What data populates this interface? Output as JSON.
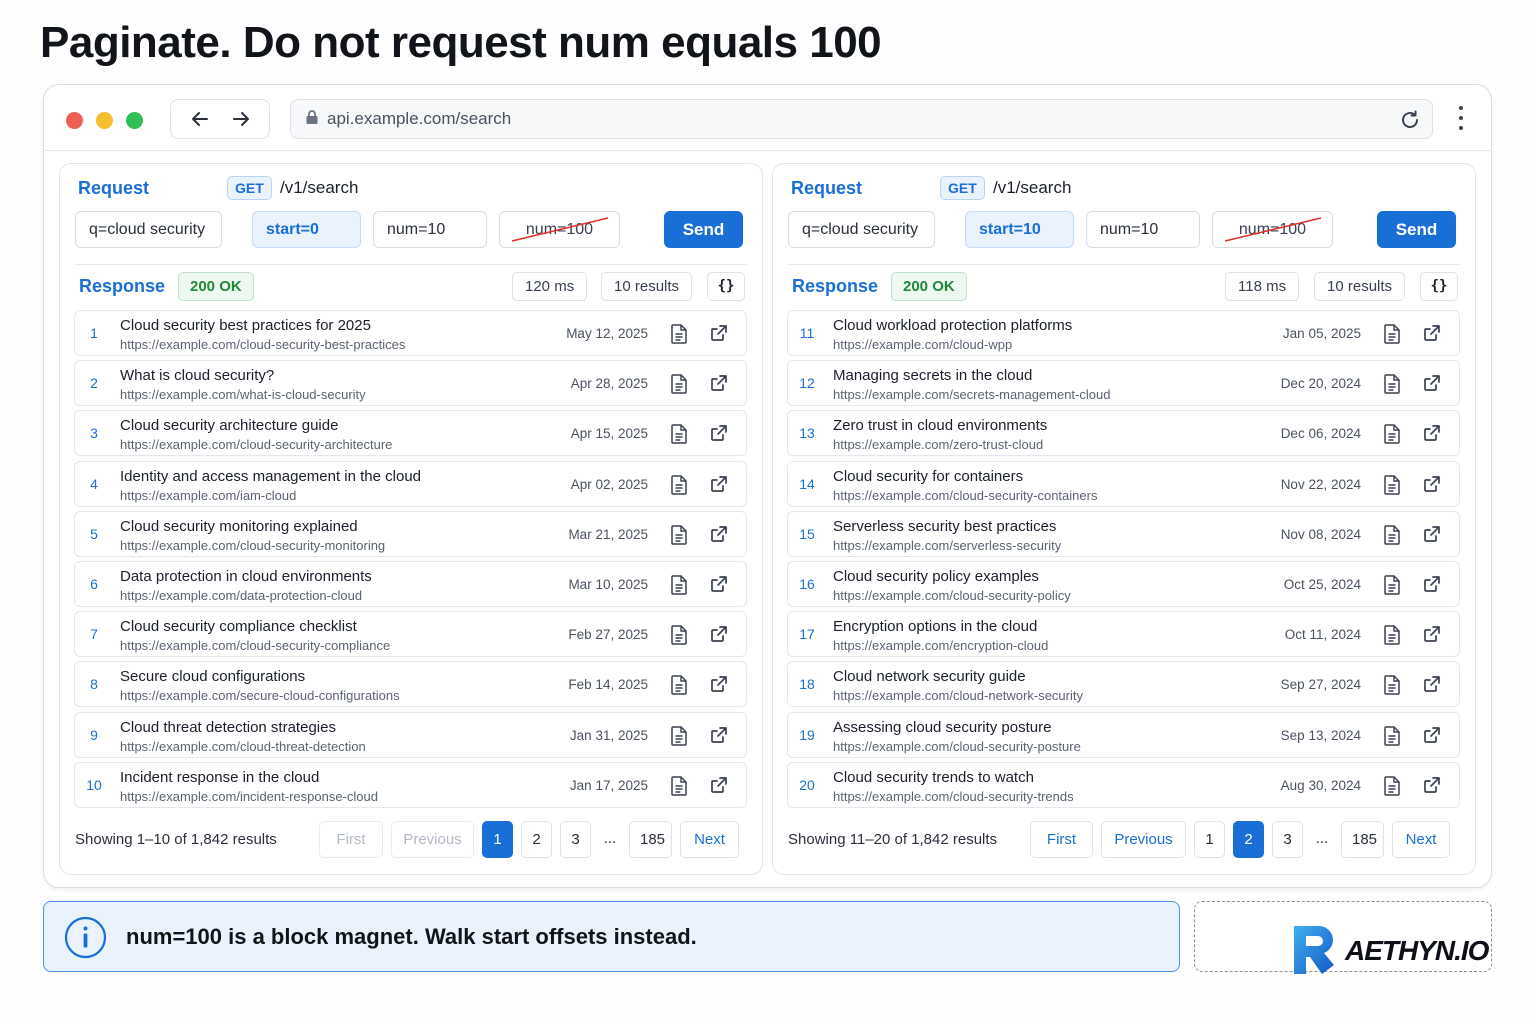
{
  "page_title": "Paginate. Do not request num equals 100",
  "browser": {
    "url": "api.example.com/search"
  },
  "panels": [
    {
      "request_label": "Request",
      "method": "GET",
      "path": "/v1/search",
      "params": {
        "q": "q=cloud security",
        "start": "start=0",
        "num": "num=10",
        "struck": "num=100"
      },
      "send_label": "Send",
      "response_label": "Response",
      "status": "200 OK",
      "time": "120 ms",
      "count": "10 results",
      "json_label": "{}",
      "results": [
        {
          "n": "1",
          "title": "Cloud security best practices for 2025",
          "url": "https://example.com/cloud-security-best-practices",
          "date": "May 12, 2025"
        },
        {
          "n": "2",
          "title": "What is cloud security?",
          "url": "https://example.com/what-is-cloud-security",
          "date": "Apr 28, 2025"
        },
        {
          "n": "3",
          "title": "Cloud security architecture guide",
          "url": "https://example.com/cloud-security-architecture",
          "date": "Apr 15, 2025"
        },
        {
          "n": "4",
          "title": "Identity and access management in the cloud",
          "url": "https://example.com/iam-cloud",
          "date": "Apr 02, 2025"
        },
        {
          "n": "5",
          "title": "Cloud security monitoring explained",
          "url": "https://example.com/cloud-security-monitoring",
          "date": "Mar 21, 2025"
        },
        {
          "n": "6",
          "title": "Data protection in cloud environments",
          "url": "https://example.com/data-protection-cloud",
          "date": "Mar 10, 2025"
        },
        {
          "n": "7",
          "title": "Cloud security compliance checklist",
          "url": "https://example.com/cloud-security-compliance",
          "date": "Feb 27, 2025"
        },
        {
          "n": "8",
          "title": "Secure cloud configurations",
          "url": "https://example.com/secure-cloud-configurations",
          "date": "Feb 14, 2025"
        },
        {
          "n": "9",
          "title": "Cloud threat detection strategies",
          "url": "https://example.com/cloud-threat-detection",
          "date": "Jan 31, 2025"
        },
        {
          "n": "10",
          "title": "Incident response in the cloud",
          "url": "https://example.com/incident-response-cloud",
          "date": "Jan 17, 2025"
        }
      ],
      "showing": "Showing 1–10 of 1,842 results",
      "pager": {
        "first": "First",
        "previous": "Previous",
        "p1": "1",
        "p2": "2",
        "p3": "3",
        "ellipsis": "...",
        "last": "185",
        "next": "Next"
      }
    },
    {
      "request_label": "Request",
      "method": "GET",
      "path": "/v1/search",
      "params": {
        "q": "q=cloud security",
        "start": "start=10",
        "num": "num=10",
        "struck": "num=100"
      },
      "send_label": "Send",
      "response_label": "Response",
      "status": "200 OK",
      "time": "118 ms",
      "count": "10 results",
      "json_label": "{}",
      "results": [
        {
          "n": "11",
          "title": "Cloud workload protection platforms",
          "url": "https://example.com/cloud-wpp",
          "date": "Jan 05, 2025"
        },
        {
          "n": "12",
          "title": "Managing secrets in the cloud",
          "url": "https://example.com/secrets-management-cloud",
          "date": "Dec 20, 2024"
        },
        {
          "n": "13",
          "title": "Zero trust in cloud environments",
          "url": "https://example.com/zero-trust-cloud",
          "date": "Dec 06, 2024"
        },
        {
          "n": "14",
          "title": "Cloud security for containers",
          "url": "https://example.com/cloud-security-containers",
          "date": "Nov 22, 2024"
        },
        {
          "n": "15",
          "title": "Serverless security best practices",
          "url": "https://example.com/serverless-security",
          "date": "Nov 08, 2024"
        },
        {
          "n": "16",
          "title": "Cloud security policy examples",
          "url": "https://example.com/cloud-security-policy",
          "date": "Oct 25, 2024"
        },
        {
          "n": "17",
          "title": "Encryption options in the cloud",
          "url": "https://example.com/encryption-cloud",
          "date": "Oct 11, 2024"
        },
        {
          "n": "18",
          "title": "Cloud network security guide",
          "url": "https://example.com/cloud-network-security",
          "date": "Sep 27, 2024"
        },
        {
          "n": "19",
          "title": "Assessing cloud security posture",
          "url": "https://example.com/cloud-security-posture",
          "date": "Sep 13, 2024"
        },
        {
          "n": "20",
          "title": "Cloud security trends to watch",
          "url": "https://example.com/cloud-security-trends",
          "date": "Aug 30, 2024"
        }
      ],
      "showing": "Showing 11–20 of 1,842 results",
      "pager": {
        "first": "First",
        "previous": "Previous",
        "p1": "1",
        "p2": "2",
        "p3": "3",
        "ellipsis": "...",
        "last": "185",
        "next": "Next"
      }
    }
  ],
  "callout": {
    "text": "num=100 is a block magnet. Walk start offsets instead.",
    "icon": "info-icon"
  },
  "logo": {
    "text": "AETHYN.IO"
  },
  "colors": {
    "accent": "#1a6fd6",
    "success": "#1f8a3c",
    "strike": "#e0342b"
  }
}
